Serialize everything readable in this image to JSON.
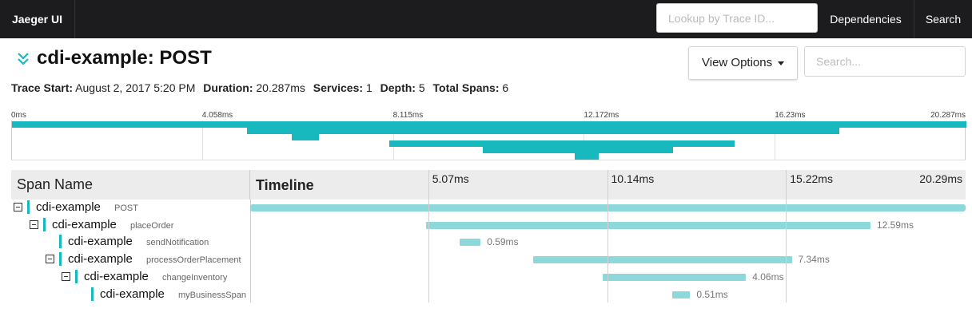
{
  "nav": {
    "brand": "Jaeger UI",
    "lookup_placeholder": "Lookup by Trace ID...",
    "dependencies": "Dependencies",
    "search": "Search"
  },
  "trace": {
    "title": "cdi-example: POST",
    "view_options": "View Options",
    "search_placeholder": "Search...",
    "meta": {
      "start_label": "Trace Start:",
      "start_value": "August 2, 2017 5:20 PM",
      "duration_label": "Duration:",
      "duration_value": "20.287ms",
      "services_label": "Services:",
      "services_value": "1",
      "depth_label": "Depth:",
      "depth_value": "5",
      "spans_label": "Total Spans:",
      "spans_value": "6"
    }
  },
  "minimap": {
    "ticks": [
      "0ms",
      "4.058ms",
      "8.115ms",
      "12.172ms",
      "16.23ms",
      "20.287ms"
    ]
  },
  "table": {
    "span_name_header": "Span Name",
    "timeline_header": "Timeline",
    "ticks": [
      "5.07ms",
      "10.14ms",
      "15.22ms",
      "20.29ms"
    ]
  },
  "colors": {
    "accent": "#17b8be",
    "span_bar": "#8dd8db",
    "nav_bg": "#1c1c1e"
  },
  "spans": [
    {
      "service": "cdi-example",
      "operation": "POST",
      "depth": 0,
      "collapsible": true,
      "start_frac": 0.0,
      "dur_frac": 1.0,
      "duration": ""
    },
    {
      "service": "cdi-example",
      "operation": "placeOrder",
      "depth": 1,
      "collapsible": true,
      "start_frac": 0.246,
      "dur_frac": 0.621,
      "duration": "12.59ms"
    },
    {
      "service": "cdi-example",
      "operation": "sendNotification",
      "depth": 2,
      "collapsible": false,
      "start_frac": 0.293,
      "dur_frac": 0.029,
      "duration": "0.59ms"
    },
    {
      "service": "cdi-example",
      "operation": "processOrderPlacement",
      "depth": 2,
      "collapsible": true,
      "start_frac": 0.395,
      "dur_frac": 0.362,
      "duration": "7.34ms"
    },
    {
      "service": "cdi-example",
      "operation": "changeInventory",
      "depth": 3,
      "collapsible": true,
      "start_frac": 0.493,
      "dur_frac": 0.2,
      "duration": "4.06ms"
    },
    {
      "service": "cdi-example",
      "operation": "myBusinessSpan",
      "depth": 4,
      "collapsible": false,
      "start_frac": 0.59,
      "dur_frac": 0.025,
      "duration": "0.51ms"
    }
  ]
}
